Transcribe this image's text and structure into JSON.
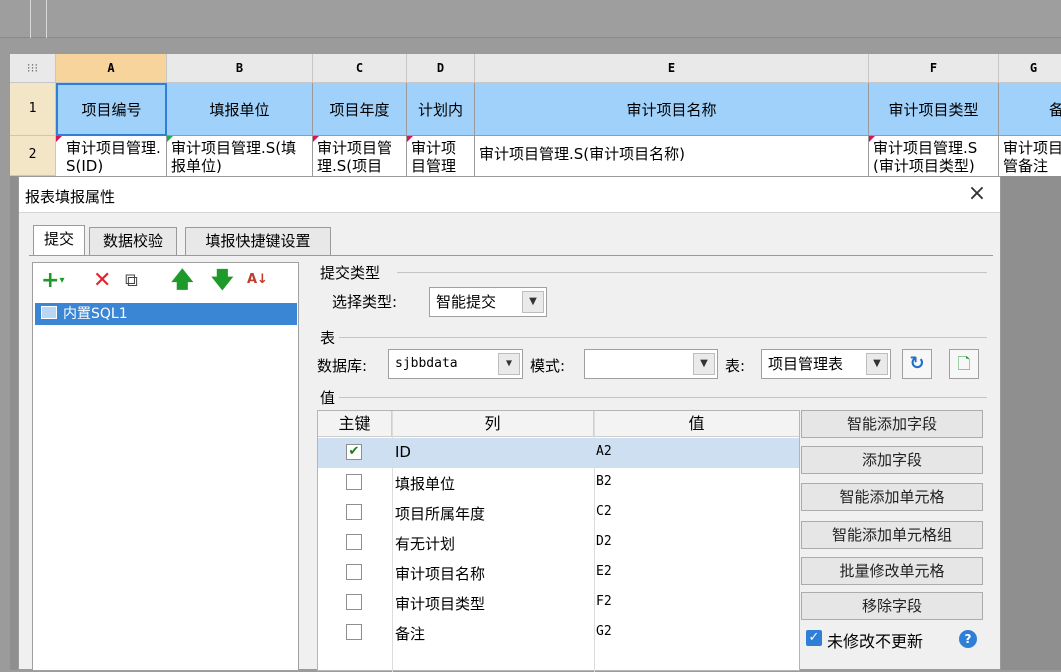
{
  "sheet": {
    "columns": [
      "A",
      "B",
      "C",
      "D",
      "E",
      "F",
      "G"
    ],
    "rows": [
      "1",
      "2"
    ],
    "header_cells": [
      "项目编号",
      "填报单位",
      "项目年度",
      "计划内",
      "审计项目名称",
      "审计项目类型",
      "备"
    ],
    "data_cells": [
      "审计项目管理.S(ID)",
      "审计项目管理.S(填报单位)",
      "审计项目管理.S(项目",
      "审计项目管理",
      "审计项目管理.S(审计项目名称)",
      "审计项目管理.S(审计项目类型)",
      "审计项目管备注"
    ]
  },
  "dialog": {
    "title": "报表填报属性",
    "close": "×",
    "tabs": [
      "提交",
      "数据校验",
      "填报快捷键设置"
    ],
    "selected_tab": "提交",
    "toolbar_icons": [
      "add-icon",
      "delete-icon",
      "copy-icon",
      "move-up-icon",
      "move-down-icon",
      "sort-icon"
    ],
    "tree": {
      "items": [
        {
          "label": "内置SQL1"
        }
      ]
    },
    "submit_type": {
      "group_label": "提交类型",
      "label": "选择类型:",
      "value": "智能提交"
    },
    "table_group": {
      "group_label": "表",
      "database_label": "数据库:",
      "database_value": "sjbbdata",
      "mode_label": "模式:",
      "mode_value": "",
      "table_label": "表:",
      "table_value": "项目管理表"
    },
    "value_group": {
      "group_label": "值",
      "headers": {
        "key": "主键",
        "column": "列",
        "value": "值"
      },
      "rows": [
        {
          "key": true,
          "column": "ID",
          "value": "A2"
        },
        {
          "key": false,
          "column": "填报单位",
          "value": "B2"
        },
        {
          "key": false,
          "column": "项目所属年度",
          "value": "C2"
        },
        {
          "key": false,
          "column": "有无计划",
          "value": "D2"
        },
        {
          "key": false,
          "column": "审计项目名称",
          "value": "E2"
        },
        {
          "key": false,
          "column": "审计项目类型",
          "value": "F2"
        },
        {
          "key": false,
          "column": "备注",
          "value": "G2"
        }
      ]
    },
    "buttons": [
      "智能添加字段",
      "添加字段",
      "智能添加单元格",
      "智能添加单元格组",
      "批量修改单元格",
      "移除字段"
    ],
    "no_modify_no_update": {
      "label": "未修改不更新",
      "checked": true
    }
  },
  "colors": {
    "accent": "#3a86d4",
    "header_fill": "#9fd1fa",
    "selected_col": "#f6d49c"
  }
}
